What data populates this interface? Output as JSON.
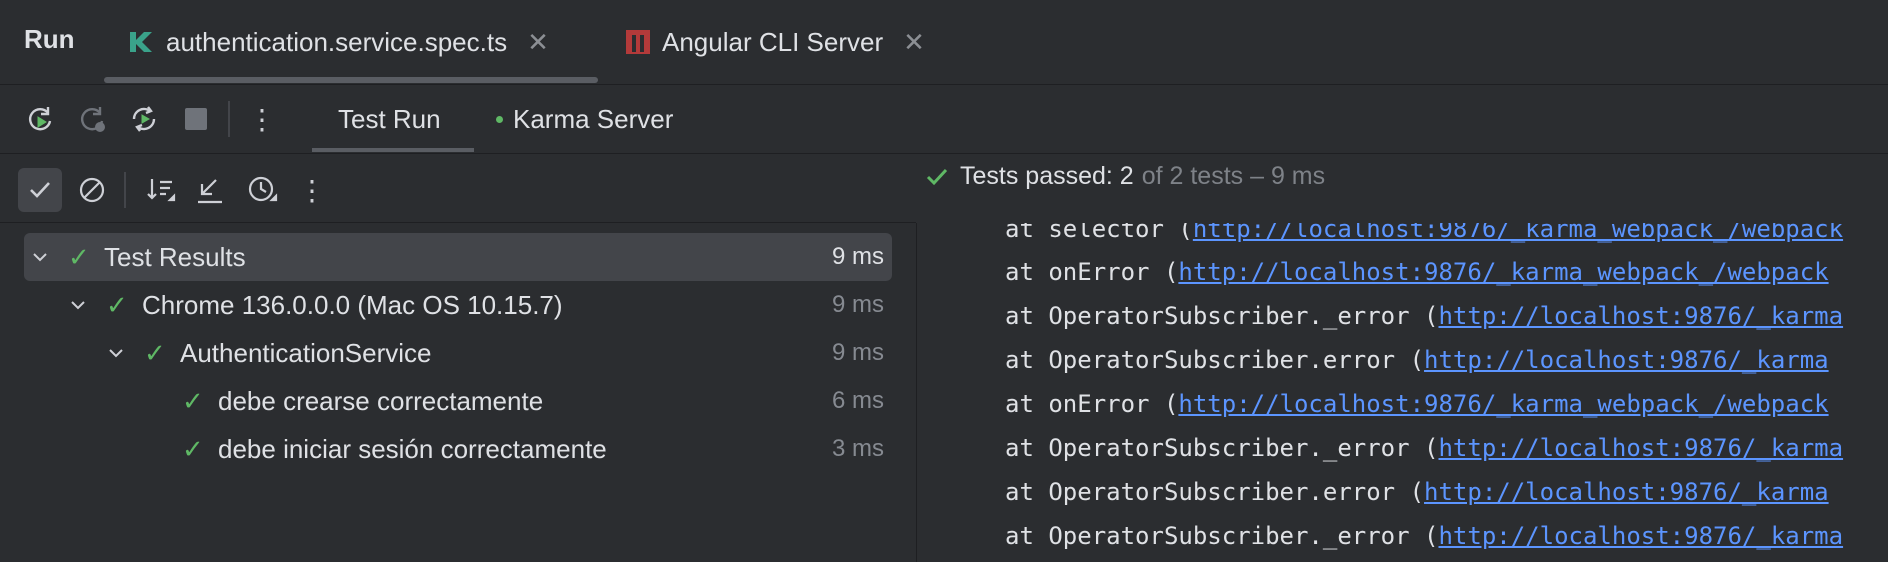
{
  "tabbar": {
    "run_label": "Run",
    "tabs": [
      {
        "label": "authentication.service.spec.ts",
        "icon": "karma-icon"
      },
      {
        "label": "Angular CLI Server",
        "icon": "angular-icon"
      }
    ]
  },
  "toolbar": {
    "icons": [
      "rerun-icon",
      "rerun-failed-icon",
      "toggle-auto-test-icon",
      "stop-icon",
      "more-vertical-icon"
    ],
    "subtabs": [
      "Test Run",
      "Karma Server"
    ]
  },
  "filterbar": {
    "icons": [
      "show-passed-icon",
      "show-ignored-icon",
      "sort-icon",
      "collapse-icon",
      "history-icon",
      "more-vertical-icon"
    ]
  },
  "status": {
    "passed_label": "Tests passed: 2",
    "rest": "of 2 tests – 9 ms"
  },
  "tree": [
    {
      "name": "Test Results",
      "time": "9 ms",
      "selected": true
    },
    {
      "name": "Chrome 136.0.0.0 (Mac OS 10.15.7)",
      "time": "9 ms"
    },
    {
      "name": "AuthenticationService",
      "time": "9 ms"
    },
    {
      "name": "debe crearse correctamente",
      "time": "6 ms"
    },
    {
      "name": "debe iniciar sesión correctamente",
      "time": "3 ms"
    }
  ],
  "console": [
    {
      "prefix": "at selector (",
      "link": "http://localhost:9876/_karma_webpack_/webpack"
    },
    {
      "prefix": "at onError (",
      "link": "http://localhost:9876/_karma_webpack_/webpack"
    },
    {
      "prefix": "at OperatorSubscriber._error (",
      "link": "http://localhost:9876/_karma"
    },
    {
      "prefix": "at OperatorSubscriber.error (",
      "link": "http://localhost:9876/_karma"
    },
    {
      "prefix": "at onError (",
      "link": "http://localhost:9876/_karma_webpack_/webpack"
    },
    {
      "prefix": "at OperatorSubscriber._error (",
      "link": "http://localhost:9876/_karma"
    },
    {
      "prefix": "at OperatorSubscriber.error (",
      "link": "http://localhost:9876/_karma"
    },
    {
      "prefix": "at OperatorSubscriber._error (",
      "link": "http://localhost:9876/_karma"
    }
  ],
  "colors": {
    "accent_green": "#5fb865",
    "link": "#5c95ff"
  }
}
